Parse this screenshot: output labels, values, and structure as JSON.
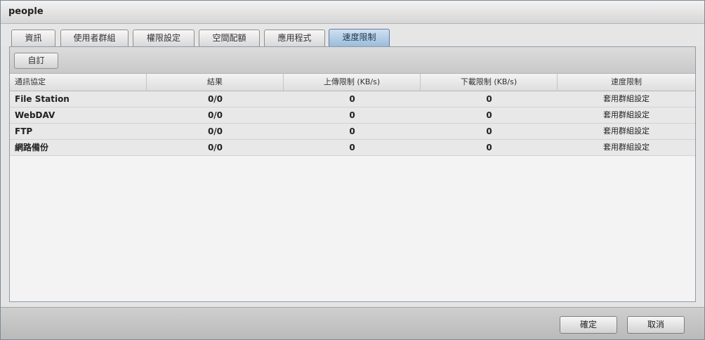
{
  "window": {
    "title": "people"
  },
  "tabs": [
    {
      "label": "資訊",
      "active": false
    },
    {
      "label": "使用者群組",
      "active": false
    },
    {
      "label": "權限設定",
      "active": false
    },
    {
      "label": "空間配額",
      "active": false
    },
    {
      "label": "應用程式",
      "active": false
    },
    {
      "label": "速度限制",
      "active": true
    }
  ],
  "toolbar": {
    "custom_label": "自訂"
  },
  "table": {
    "columns": [
      "通訊協定",
      "結果",
      "上傳限制 (KB/s)",
      "下載限制 (KB/s)",
      "速度限制"
    ],
    "rows": [
      [
        "File Station",
        "0/0",
        "0",
        "0",
        "套用群組設定"
      ],
      [
        "WebDAV",
        "0/0",
        "0",
        "0",
        "套用群組設定"
      ],
      [
        "FTP",
        "0/0",
        "0",
        "0",
        "套用群組設定"
      ],
      [
        "網路備份",
        "0/0",
        "0",
        "0",
        "套用群組設定"
      ]
    ]
  },
  "footer": {
    "ok_label": "確定",
    "cancel_label": "取消"
  }
}
